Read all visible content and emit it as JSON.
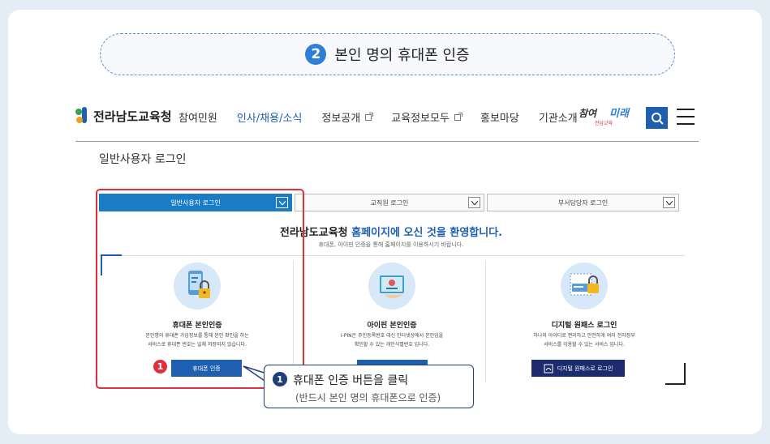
{
  "step": {
    "number": "2",
    "title": "본인 명의 휴대폰 인증"
  },
  "header": {
    "logo_text": "전라남도교육청",
    "nav": [
      {
        "label": "참여민원",
        "external": false
      },
      {
        "label": "인사/채용/소식",
        "external": false
      },
      {
        "label": "정보공개",
        "external": true
      },
      {
        "label": "교육정보모두",
        "external": true
      },
      {
        "label": "홍보마당",
        "external": false
      },
      {
        "label": "기관소개",
        "external": false
      }
    ],
    "slogan_main": "참여",
    "slogan_accent": "미래",
    "slogan_sub": "전남교육"
  },
  "page_subtitle": "일반사용자 로그인",
  "tabs": [
    {
      "label": "일반사용자 로그인",
      "active": true
    },
    {
      "label": "교직원 로그인",
      "active": false
    },
    {
      "label": "부서담당자 로그인",
      "active": false
    }
  ],
  "welcome": {
    "part1": "전라남도교육청 ",
    "part2": "홈페이지에 오신 것을 환영합니다.",
    "sub": "휴대폰, 아이핀 인증을 통해 홈페이지를 이용하시기 바랍니다."
  },
  "methods": [
    {
      "title": "휴대폰 본인인증",
      "desc1": "본인명의 휴대폰 가입정보를 통해 본인 확인을 하는",
      "desc2": "서비스로 휴대폰 번호는 일체 저장되지 않습니다.",
      "button": "휴대폰 인증"
    },
    {
      "title": "아이핀 본인인증",
      "desc1": "I-PIN은 주민등록번호 대신 인터넷상에서 본인임을",
      "desc2": "확인할 수 있는 개인식별번호 입니다.",
      "button": ""
    },
    {
      "title": "디지털 원패스 로그인",
      "desc1": "하나의 아이디로 편리하고 안전하게 여러 전자정부",
      "desc2": "서비스를 이용할 수 있는 서비스 입니다.",
      "button": "디지털 원패스로 로그인"
    }
  ],
  "marker_num": "1",
  "callout": {
    "num": "1",
    "line1": "휴대폰 인증 버튼을 클릭",
    "line2": "(반드시 본인 명의 휴대폰으로 인증)"
  },
  "colors": {
    "primary": "#1f5fb0",
    "tab_active": "#1a7cc4",
    "highlight": "#e03040",
    "callout_border": "#1f3f7a"
  },
  "icons": [
    "search-icon",
    "menu-icon",
    "phone-lock-icon",
    "ipin-card-icon",
    "onepass-lock-icon",
    "chevron-down-icon",
    "external-link-icon"
  ]
}
